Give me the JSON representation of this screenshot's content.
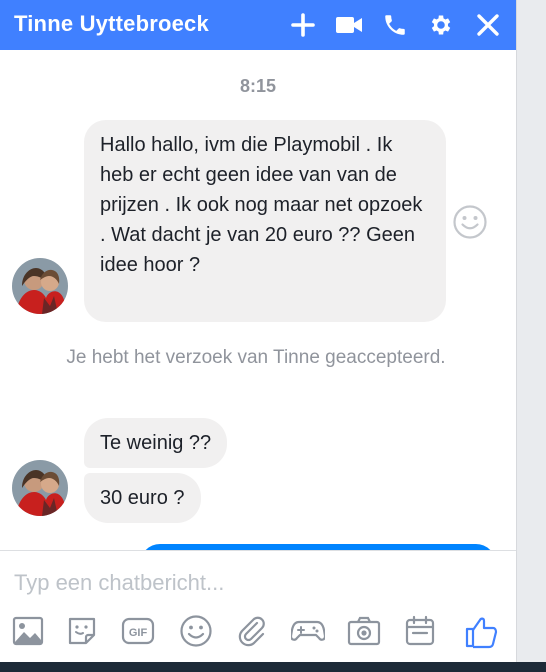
{
  "header": {
    "contact_name": "Tinne Uyttebroeck",
    "icons": [
      "plus-icon",
      "video-camera-icon",
      "phone-icon",
      "gear-icon",
      "close-icon"
    ],
    "background": "#4080ff"
  },
  "conversation": {
    "timestamp": "8:15",
    "messages": [
      {
        "sender": "contact",
        "text": "Hallo hallo, ivm die Playmobil . Ik heb er echt geen idee van van de prijzen . Ik ook nog maar net opzoek . Wat dacht je van 20 euro ?? Geen idee hoor ?"
      },
      {
        "sender": "contact",
        "text": "Te weinig ??"
      },
      {
        "sender": "contact",
        "text": "30 euro ?"
      }
    ],
    "system_notice": "Je hebt het verzoek van Tinne geaccepteerd.",
    "own_bubble_color": "#0084ff"
  },
  "composer": {
    "placeholder": "Typ een chatbericht...",
    "tools": [
      "image-icon",
      "sticker-icon",
      "gif-icon",
      "emoji-icon",
      "attachment-icon",
      "game-icon",
      "camera-icon",
      "calendar-icon",
      "thumbs-up-icon"
    ],
    "gif_label": "GIF"
  }
}
